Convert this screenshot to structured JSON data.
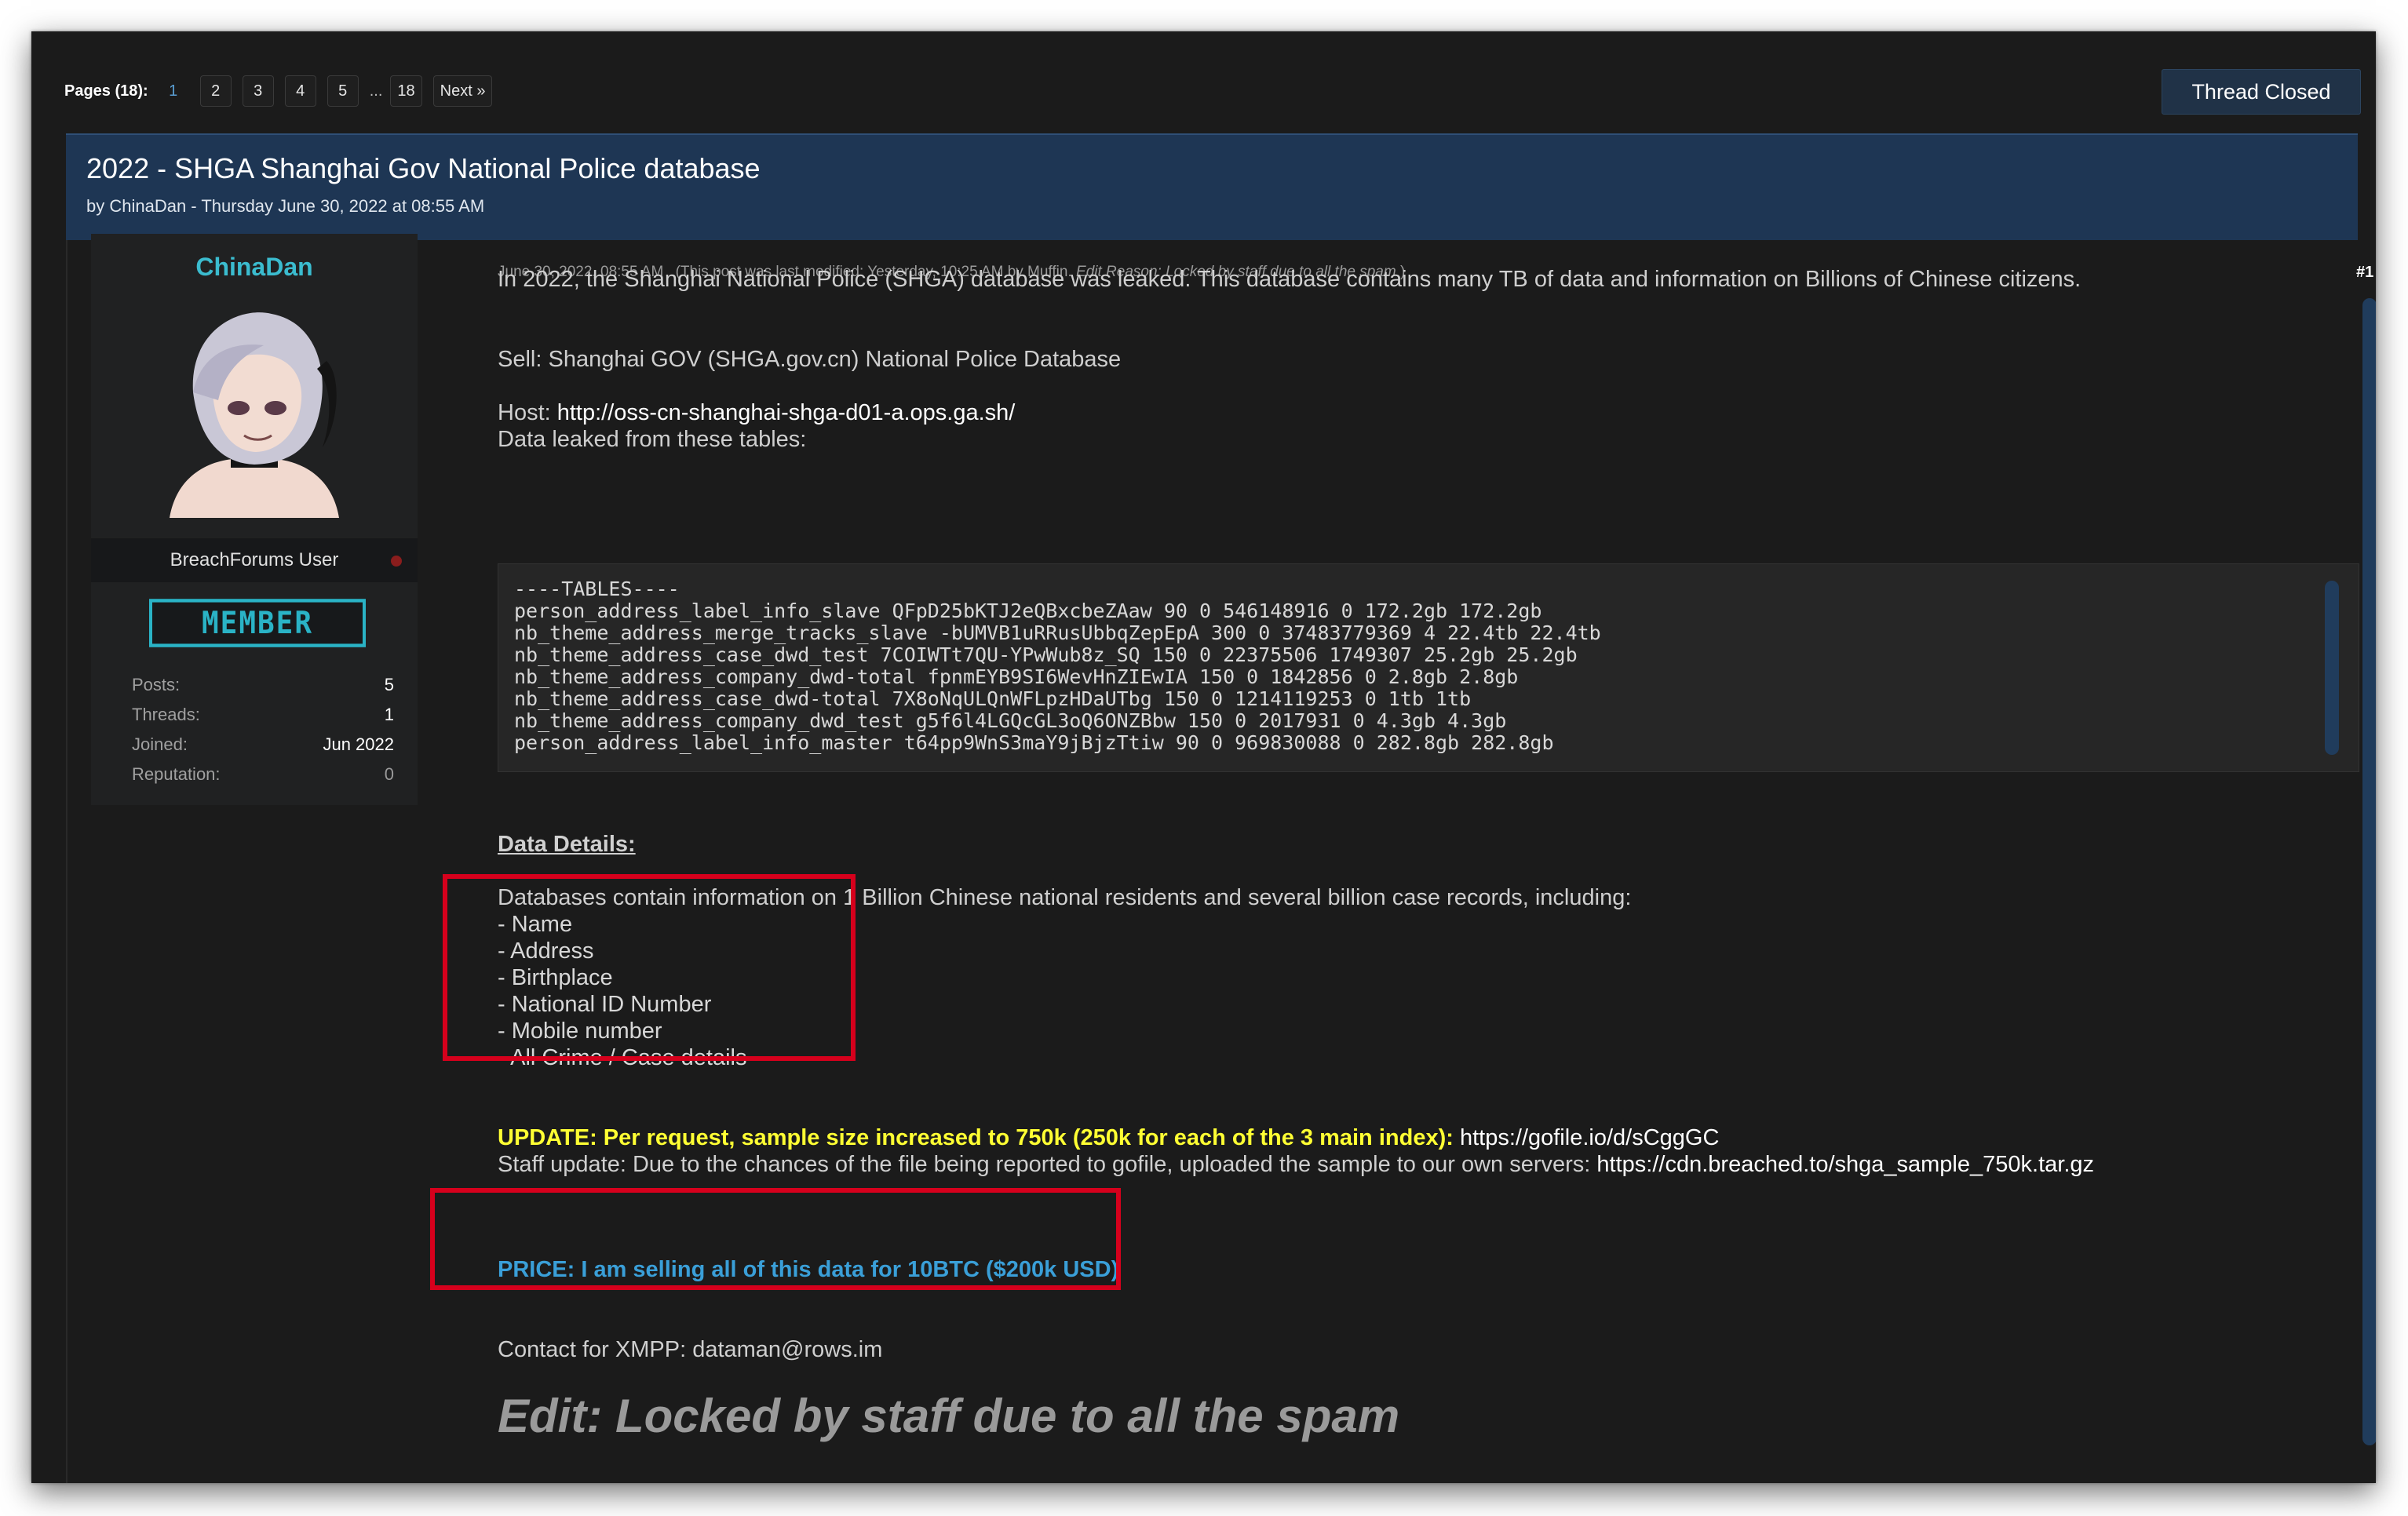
{
  "pagination": {
    "label": "Pages (18):",
    "pages": [
      "1",
      "2",
      "3",
      "4",
      "5"
    ],
    "ellipsis": "...",
    "last": "18",
    "next": "Next »",
    "current": "1"
  },
  "thread_closed_label": "Thread Closed",
  "thread": {
    "title": "2022 - SHGA Shanghai Gov National Police database",
    "subtitle": "by ChinaDan - Thursday June 30, 2022 at 08:55 AM"
  },
  "user": {
    "name": "ChinaDan",
    "title": "BreachForums User",
    "badge": "MEMBER",
    "stats": [
      {
        "label": "Posts:",
        "value": "5"
      },
      {
        "label": "Threads:",
        "value": "1"
      },
      {
        "label": "Joined:",
        "value": "Jun 2022"
      },
      {
        "label": "Reputation:",
        "value": "0"
      }
    ]
  },
  "post": {
    "date": "June 30, 2022, 08:55 AM",
    "modified_prefix": "(This post was last modified: Yesterday, 10:25 AM by Muffin.",
    "edit_reason": "Edit Reason: Locked by staff due to all the spam",
    "modified_suffix": ")",
    "number": "#1",
    "intro": "In 2022, the Shanghai National Police (SHGA) database was leaked. This database contains many TB of data and information on Billions of Chinese citizens.",
    "sell": "Sell: Shanghai GOV (SHGA.gov.cn) National Police Database",
    "host_label": "Host:",
    "host_url": "http://oss-cn-shanghai-shga-d01-a.ops.ga.sh/",
    "tables_intro": "Data leaked from these tables:",
    "tables": [
      "----TABLES----",
      "person_address_label_info_slave QFpD25bKTJ2eQBxcbeZAaw 90 0 546148916 0 172.2gb 172.2gb",
      "nb_theme_address_merge_tracks_slave -bUMVB1uRRusUbbqZepEpA 300 0 37483779369 4 22.4tb 22.4tb",
      "nb_theme_address_case_dwd_test 7COIWTt7QU-YPwWub8z_SQ 150 0 22375506 1749307 25.2gb 25.2gb",
      "nb_theme_address_company_dwd-total fpnmEYB9SI6WevHnZIEwIA 150 0 1842856 0 2.8gb 2.8gb",
      "nb_theme_address_case_dwd-total 7X8oNqULQnWFLpzHDaUTbg 150 0 1214119253 0 1tb 1tb",
      "nb_theme_address_company_dwd_test g5f6l4LGQcGL3oQ6ONZBbw 150 0 2017931 0 4.3gb 4.3gb",
      "person_address_label_info_master t64pp9WnS3maY9jBjzTtiw 90 0 969830088 0 282.8gb 282.8gb"
    ],
    "details_heading": "Data Details:",
    "details_intro": "Databases contain information on 1 Billion Chinese national residents and several billion case records, including:",
    "details_items": [
      "- Name",
      "- Address",
      "- Birthplace",
      "- National ID Number",
      "- Mobile number",
      "- All Crime / Case details"
    ],
    "update_bold": "UPDATE: Per request, sample size increased to 750k (250k for each of the 3 main index):",
    "update_link": "https://gofile.io/d/sCggGC",
    "staff_update": "Staff update: Due to the chances of the file being reported to gofile, uploaded the sample to our own servers:",
    "staff_link": "https://cdn.breached.to/shga_sample_750k.tar.gz",
    "price": "PRICE: I am selling all of this data for 10BTC ($200k USD)",
    "contact": "Contact for XMPP: dataman@rows.im",
    "edit_note": "Edit: Locked by staff due to all the spam"
  },
  "colors": {
    "highlight_box": "#d6001c",
    "update_text": "#ffff33",
    "price_text": "#3a9fd8",
    "username": "#3bbccf",
    "title_bar": "#1e3654"
  }
}
